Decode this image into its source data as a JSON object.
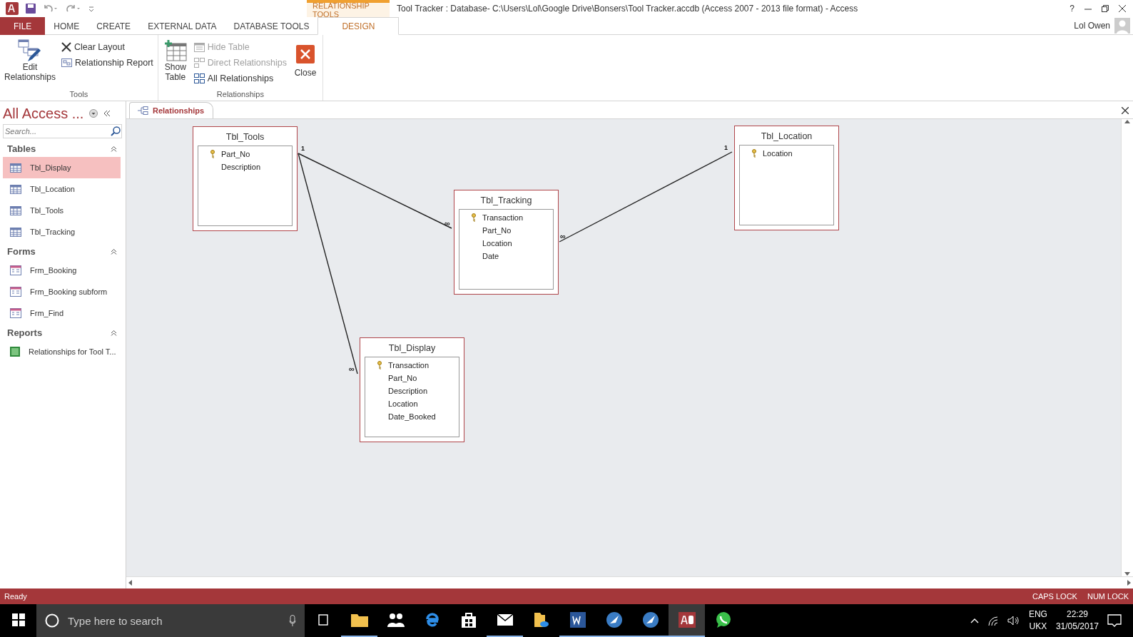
{
  "title_bar": {
    "context_tab": "RELATIONSHIP TOOLS",
    "title": "Tool Tracker : Database- C:\\Users\\Lol\\Google Drive\\Bonsers\\Tool Tracker.accdb (Access 2007 - 2013 file format) - Access",
    "help": "?",
    "user": "Lol Owen"
  },
  "ribbon_tabs": [
    {
      "label": "FILE",
      "kind": "file",
      "selected": false
    },
    {
      "label": "HOME",
      "kind": "tab",
      "selected": false
    },
    {
      "label": "CREATE",
      "kind": "tab",
      "selected": false
    },
    {
      "label": "EXTERNAL DATA",
      "kind": "tab",
      "selected": false
    },
    {
      "label": "DATABASE TOOLS",
      "kind": "tab",
      "selected": false
    },
    {
      "label": "DESIGN",
      "kind": "tab",
      "selected": true
    }
  ],
  "ribbon_groups": [
    {
      "label": "Tools",
      "large": [
        {
          "label": "Edit Relationships",
          "kind": "edit"
        }
      ],
      "small": [
        {
          "label": "Clear Layout",
          "kind": "clear",
          "disabled": false
        },
        {
          "label": "Relationship Report",
          "kind": "report",
          "disabled": false
        }
      ]
    },
    {
      "label": "Relationships",
      "large": [
        {
          "label": "Show Table",
          "kind": "show"
        }
      ],
      "small": [
        {
          "label": "Hide Table",
          "kind": "hide",
          "disabled": true
        },
        {
          "label": "Direct Relationships",
          "kind": "direct",
          "disabled": true
        },
        {
          "label": "All Relationships",
          "kind": "all",
          "disabled": false
        }
      ],
      "trailing": [
        {
          "label": "Close",
          "kind": "close"
        }
      ]
    }
  ],
  "nav_pane": {
    "title": "All Access ...",
    "search": {
      "placeholder": "Search..."
    },
    "sections": [
      {
        "label": "Tables",
        "items": [
          {
            "label": "Tbl_Display",
            "kind": "table",
            "selected": true
          },
          {
            "label": "Tbl_Location",
            "kind": "table",
            "selected": false
          },
          {
            "label": "Tbl_Tools",
            "kind": "table",
            "selected": false
          },
          {
            "label": "Tbl_Tracking",
            "kind": "table",
            "selected": false
          }
        ]
      },
      {
        "label": "Forms",
        "items": [
          {
            "label": "Frm_Booking",
            "kind": "form",
            "selected": false
          },
          {
            "label": "Frm_Booking subform",
            "kind": "form",
            "selected": false
          },
          {
            "label": "Frm_Find",
            "kind": "form",
            "selected": false
          }
        ]
      },
      {
        "label": "Reports",
        "items": [
          {
            "label": "Relationships for Tool T...",
            "kind": "report",
            "selected": false
          }
        ]
      }
    ]
  },
  "document_tab": {
    "label": "Relationships"
  },
  "tables": [
    {
      "name": "Tbl_Tools",
      "fields": [
        {
          "name": "Part_No",
          "key": true
        },
        {
          "name": "Description",
          "key": false
        }
      ]
    },
    {
      "name": "Tbl_Tracking",
      "fields": [
        {
          "name": "Transaction",
          "key": true
        },
        {
          "name": "Part_No",
          "key": false
        },
        {
          "name": "Location",
          "key": false
        },
        {
          "name": "Date",
          "key": false
        }
      ]
    },
    {
      "name": "Tbl_Location",
      "fields": [
        {
          "name": "Location",
          "key": true
        }
      ]
    },
    {
      "name": "Tbl_Display",
      "fields": [
        {
          "name": "Transaction",
          "key": true
        },
        {
          "name": "Part_No",
          "key": false
        },
        {
          "name": "Description",
          "key": false
        },
        {
          "name": "Location",
          "key": false
        },
        {
          "name": "Date_Booked",
          "key": false
        }
      ]
    }
  ],
  "relationships": [
    {
      "one_label": "1",
      "many_label": "∞"
    },
    {
      "many_label": "∞"
    },
    {
      "one_label": "1",
      "many_label": "∞"
    }
  ],
  "status_bar": {
    "text": "Ready",
    "indicators": [
      "CAPS LOCK",
      "NUM LOCK"
    ]
  },
  "taskbar": {
    "search": {
      "placeholder": "Type here to search"
    },
    "language": "ENG",
    "layout": "UKX",
    "time": "22:29",
    "date": "31/05/2017"
  }
}
